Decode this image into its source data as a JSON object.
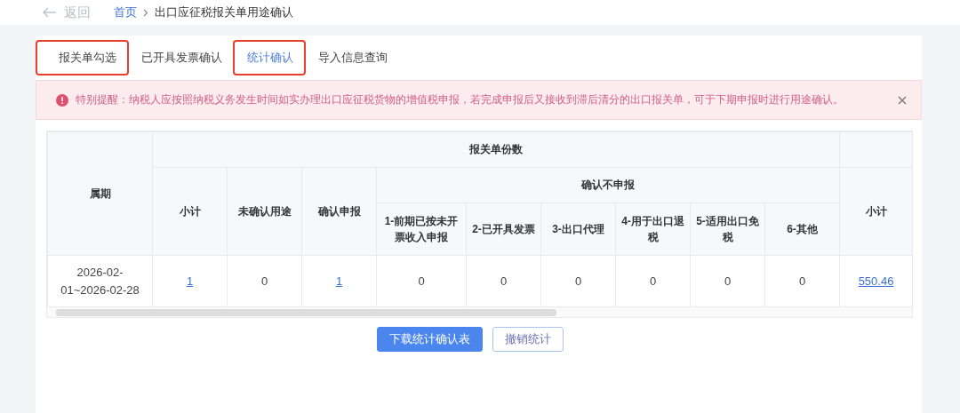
{
  "header": {
    "back_label": "返回",
    "breadcrumb": [
      {
        "label": "首页",
        "kind": "link"
      },
      {
        "label": "出口应征税报关单用途确认",
        "kind": "current"
      }
    ]
  },
  "tabs": [
    {
      "label": "报关单勾选",
      "selected": false,
      "annotated": true
    },
    {
      "label": "已开具发票确认",
      "selected": false,
      "annotated": false
    },
    {
      "label": "统计确认",
      "selected": true,
      "annotated": true
    },
    {
      "label": "导入信息查询",
      "selected": false,
      "annotated": false
    }
  ],
  "alert": {
    "text": "特别提醒：纳税人应按照纳税义务发生时间如实办理出口应征税货物的增值税申报，若完成申报后又接收到滞后清分的出口报关单，可于下期申报时进行用途确认。"
  },
  "table": {
    "period_column": "属期",
    "group_header": "报关单份数",
    "group_columns": [
      "小计",
      "未确认用途",
      "确认申报"
    ],
    "sub_group_header": "确认不申报",
    "sub_group_columns": [
      "1-前期已按未开票收入申报",
      "2-已开具发票",
      "3-出口代理",
      "4-用于出口退税",
      "5-适用出口免税",
      "6-其他"
    ],
    "total_column": "小计",
    "rows": [
      {
        "period": "2026-02-01~2026-02-28",
        "cells": [
          {
            "text": "1",
            "kind": "link"
          },
          {
            "text": "0",
            "kind": "plain"
          },
          {
            "text": "1",
            "kind": "link"
          },
          {
            "text": "0",
            "kind": "plain"
          },
          {
            "text": "0",
            "kind": "plain"
          },
          {
            "text": "0",
            "kind": "plain"
          },
          {
            "text": "0",
            "kind": "plain"
          },
          {
            "text": "0",
            "kind": "plain"
          },
          {
            "text": "0",
            "kind": "plain"
          },
          {
            "text": "550.46",
            "kind": "link"
          }
        ]
      }
    ]
  },
  "buttons": [
    {
      "label": "下载统计确认表",
      "kind": "primary"
    },
    {
      "label": "撤销统计",
      "kind": "secondary"
    }
  ]
}
